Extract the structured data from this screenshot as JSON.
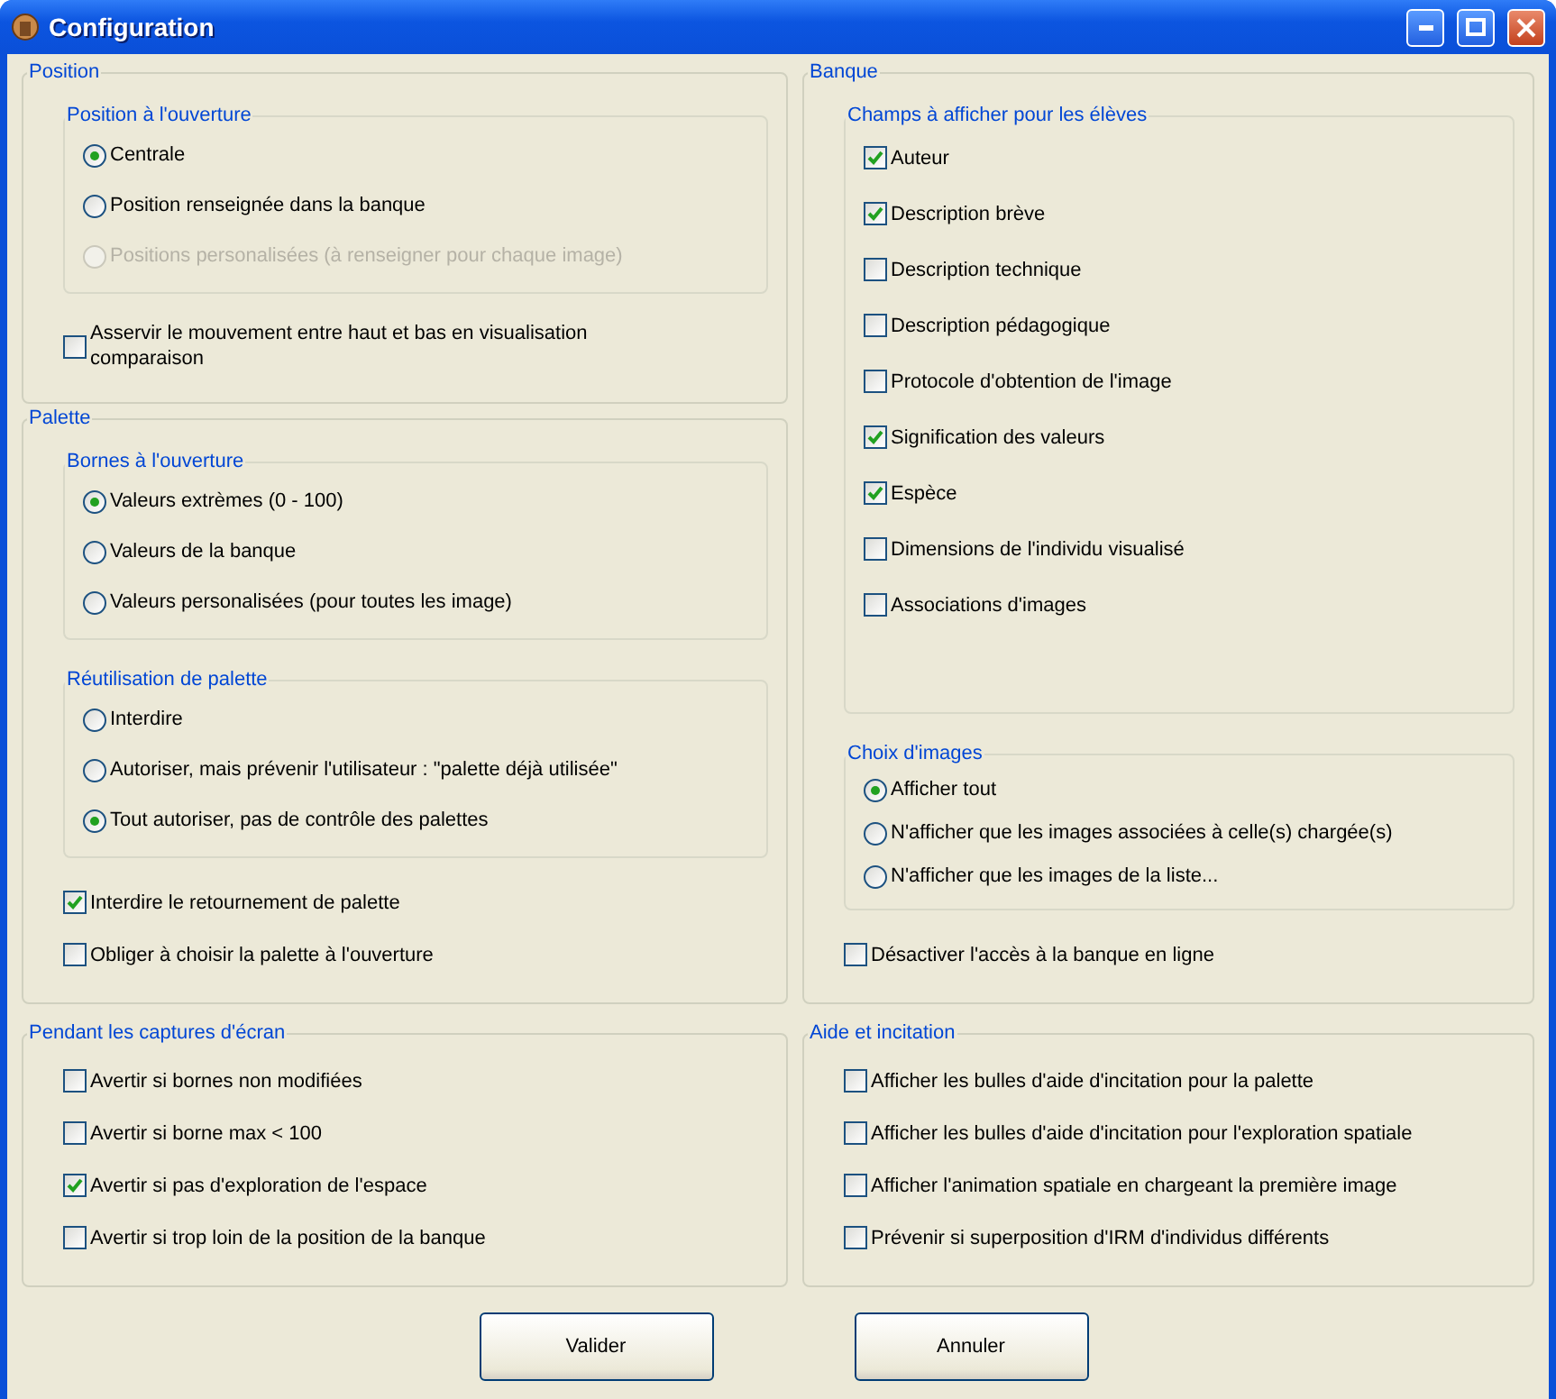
{
  "window": {
    "title": "Configuration"
  },
  "columns": [
    [
      {
        "title": "Position",
        "items": [
          {
            "kind": "subgroup",
            "title": "Position à l'ouverture",
            "items": [
              {
                "kind": "radio",
                "label": "Centrale",
                "selected": true,
                "disabled": false
              },
              {
                "kind": "radio",
                "label": "Position renseignée dans la banque",
                "selected": false,
                "disabled": false
              },
              {
                "kind": "radio",
                "label": "Positions personalisées (à renseigner pour chaque image)",
                "selected": false,
                "disabled": true
              }
            ]
          },
          {
            "kind": "checkbox",
            "label": "Asservir le mouvement entre haut et bas en visualisation comparaison",
            "checked": false
          }
        ]
      },
      {
        "title": "Palette",
        "items": [
          {
            "kind": "subgroup",
            "title": "Bornes à l'ouverture",
            "items": [
              {
                "kind": "radio",
                "label": "Valeurs extrèmes (0 - 100)",
                "selected": true,
                "disabled": false
              },
              {
                "kind": "radio",
                "label": "Valeurs de la banque",
                "selected": false,
                "disabled": false
              },
              {
                "kind": "radio",
                "label": "Valeurs personalisées (pour toutes les image)",
                "selected": false,
                "disabled": false
              }
            ]
          },
          {
            "kind": "subgroup",
            "title": "Réutilisation de palette",
            "items": [
              {
                "kind": "radio",
                "label": "Interdire",
                "selected": false,
                "disabled": false
              },
              {
                "kind": "radio",
                "label": "Autoriser, mais prévenir l'utilisateur : \"palette déjà utilisée\"",
                "selected": false,
                "disabled": false
              },
              {
                "kind": "radio",
                "label": "Tout autoriser, pas de contrôle des palettes",
                "selected": true,
                "disabled": false
              }
            ]
          },
          {
            "kind": "checkbox",
            "label": "Interdire le retournement de palette",
            "checked": true
          },
          {
            "kind": "checkbox",
            "label": "Obliger à choisir la palette à l'ouverture",
            "checked": false
          }
        ]
      }
    ],
    [
      {
        "title": "Banque",
        "items": [
          {
            "kind": "subgroup",
            "title": "Champs à afficher pour les élèves",
            "items": [
              {
                "kind": "checkbox",
                "label": "Auteur",
                "checked": true
              },
              {
                "kind": "checkbox",
                "label": "Description brève",
                "checked": true
              },
              {
                "kind": "checkbox",
                "label": "Description technique",
                "checked": false
              },
              {
                "kind": "checkbox",
                "label": "Description pédagogique",
                "checked": false
              },
              {
                "kind": "checkbox",
                "label": "Protocole d'obtention de l'image",
                "checked": false
              },
              {
                "kind": "checkbox",
                "label": "Signification des valeurs",
                "checked": true
              },
              {
                "kind": "checkbox",
                "label": "Espèce",
                "checked": true
              },
              {
                "kind": "checkbox",
                "label": "Dimensions de l'individu visualisé",
                "checked": false
              },
              {
                "kind": "checkbox",
                "label": "Associations d'images",
                "checked": false
              }
            ]
          },
          {
            "kind": "subgroup",
            "title": "Choix d'images",
            "items": [
              {
                "kind": "radio",
                "label": "Afficher tout",
                "selected": true,
                "disabled": false
              },
              {
                "kind": "radio",
                "label": "N'afficher que les images associées à celle(s) chargée(s)",
                "selected": false,
                "disabled": false
              },
              {
                "kind": "radio",
                "label": "N'afficher que les images de la liste...",
                "selected": false,
                "disabled": false
              }
            ]
          },
          {
            "kind": "checkbox",
            "label": "Désactiver l'accès à la banque en ligne",
            "checked": false
          }
        ]
      }
    ]
  ],
  "bottom": [
    {
      "title": "Pendant les captures d'écran",
      "items": [
        {
          "kind": "checkbox",
          "label": "Avertir si bornes non modifiées",
          "checked": false
        },
        {
          "kind": "checkbox",
          "label": "Avertir si borne max < 100",
          "checked": false
        },
        {
          "kind": "checkbox",
          "label": "Avertir si pas d'exploration de l'espace",
          "checked": true
        },
        {
          "kind": "checkbox",
          "label": "Avertir si trop loin de la position de la banque",
          "checked": false
        }
      ]
    },
    {
      "title": "Aide et incitation",
      "items": [
        {
          "kind": "checkbox",
          "label": "Afficher les bulles d'aide d'incitation pour la palette",
          "checked": false
        },
        {
          "kind": "checkbox",
          "label": "Afficher les bulles d'aide d'incitation pour l'exploration spatiale",
          "checked": false
        },
        {
          "kind": "checkbox",
          "label": "Afficher l'animation spatiale en chargeant la première image",
          "checked": false
        },
        {
          "kind": "checkbox",
          "label": "Prévenir si superposition d'IRM d'individus différents",
          "checked": false
        }
      ]
    }
  ],
  "buttons": [
    "Valider",
    "Annuler"
  ]
}
